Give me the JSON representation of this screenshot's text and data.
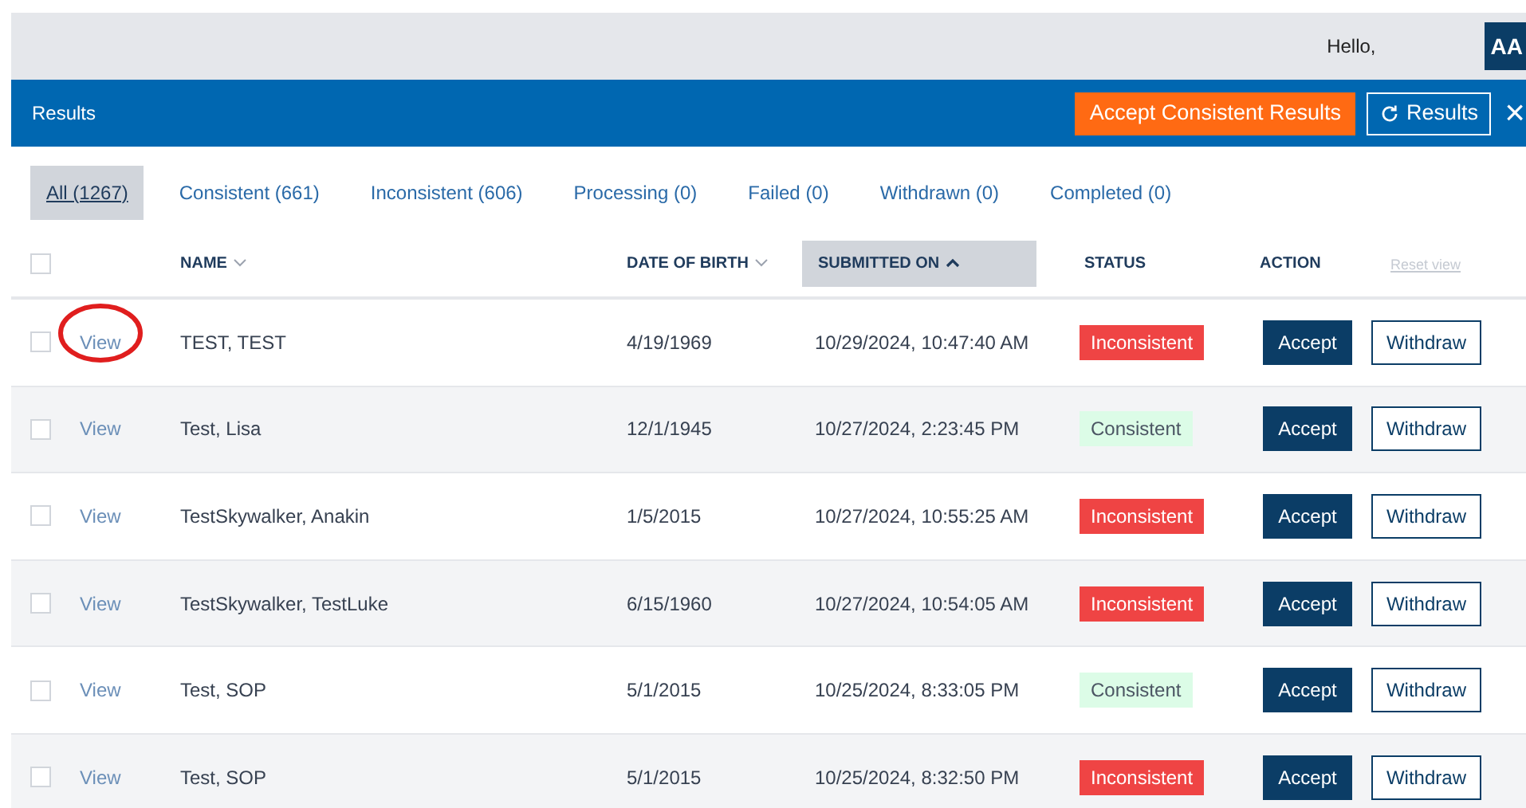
{
  "topbar": {
    "greeting": "Hello,",
    "avatar": "AA"
  },
  "header": {
    "title": "Results",
    "accept_all": "Accept Consistent Results",
    "refresh": "Results",
    "close": "×"
  },
  "tabs": [
    {
      "label": "All (1267)",
      "selected": true
    },
    {
      "label": "Consistent (661)",
      "selected": false
    },
    {
      "label": "Inconsistent (606)",
      "selected": false
    },
    {
      "label": "Processing (0)",
      "selected": false
    },
    {
      "label": "Failed (0)",
      "selected": false
    },
    {
      "label": "Withdrawn (0)",
      "selected": false
    },
    {
      "label": "Completed (0)",
      "selected": false
    }
  ],
  "table": {
    "select_all": {
      "checked": false
    },
    "columns": [
      {
        "label": "NAME",
        "sortable": true,
        "sorted": false
      },
      {
        "label": "DATE OF BIRTH",
        "sortable": true,
        "sorted": false
      },
      {
        "label": "SUBMITTED ON",
        "sortable": true,
        "sorted": true
      },
      {
        "label": "STATUS",
        "sortable": false,
        "sorted": false
      },
      {
        "label": "ACTION",
        "sortable": false,
        "sorted": false
      }
    ],
    "reset": "Reset view",
    "rows": [
      {
        "checked": false,
        "view": "View",
        "circled": true,
        "name": "TEST,  TEST",
        "dob": "4/19/1969",
        "submitted": "10/29/2024, 10:47:40 AM",
        "status": "Inconsistent",
        "color": "#ef4444",
        "accept": "Accept",
        "withdraw": "Withdraw"
      },
      {
        "checked": false,
        "view": "View",
        "circled": false,
        "name": "Test,  Lisa",
        "dob": "12/1/1945",
        "submitted": "10/27/2024, 2:23:45 PM",
        "status": "Consistent",
        "color": "#dcfce7",
        "accept": "Accept",
        "withdraw": "Withdraw"
      },
      {
        "checked": false,
        "view": "View",
        "circled": false,
        "name": "TestSkywalker,  Anakin",
        "dob": "1/5/2015",
        "submitted": "10/27/2024, 10:55:25 AM",
        "status": "Inconsistent",
        "color": "#ef4444",
        "accept": "Accept",
        "withdraw": "Withdraw"
      },
      {
        "checked": false,
        "view": "View",
        "circled": false,
        "name": "TestSkywalker,  TestLuke",
        "dob": "6/15/1960",
        "submitted": "10/27/2024, 10:54:05 AM",
        "status": "Inconsistent",
        "color": "#ef4444",
        "accept": "Accept",
        "withdraw": "Withdraw"
      },
      {
        "checked": false,
        "view": "View",
        "circled": false,
        "name": "Test,  SOP",
        "dob": "5/1/2015",
        "submitted": "10/25/2024, 8:33:05 PM",
        "status": "Consistent",
        "color": "#dcfce7",
        "accept": "Accept",
        "withdraw": "Withdraw"
      },
      {
        "checked": false,
        "view": "View",
        "circled": false,
        "name": "Test,  SOP",
        "dob": "5/1/2015",
        "submitted": "10/25/2024, 8:32:50 PM",
        "status": "Inconsistent",
        "color": "#ef4444",
        "accept": "Accept",
        "withdraw": "Withdraw"
      }
    ]
  }
}
